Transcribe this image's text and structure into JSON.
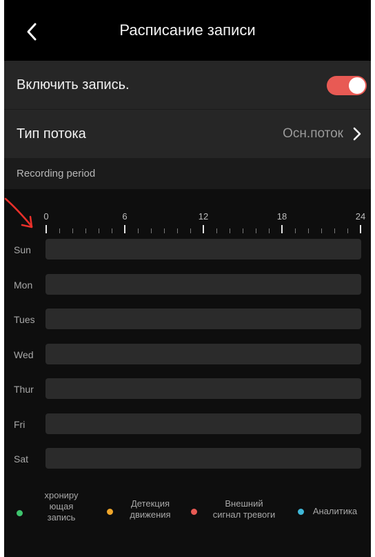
{
  "header": {
    "title": "Расписание записи",
    "back_icon": "chevron-left-icon"
  },
  "settings": {
    "enable": {
      "label": "Включить запись.",
      "toggle_on": true,
      "toggle_color": "#e85a54"
    },
    "stream": {
      "label": "Тип потока",
      "value": "Осн.поток"
    }
  },
  "schedule": {
    "title": "Recording period",
    "hour_labels": [
      "0",
      "6",
      "12",
      "18",
      "24"
    ],
    "days": [
      "Sun",
      "Mon",
      "Tues",
      "Wed",
      "Thur",
      "Fri",
      "Sat"
    ]
  },
  "legend": [
    {
      "label": "хрониру\nющая\nзапись",
      "color": "#3ec46d"
    },
    {
      "label": "Детекция\nдвижения",
      "color": "#f0a62a"
    },
    {
      "label": "Внешний\nсигнал тревоги",
      "color": "#e85a54"
    },
    {
      "label": "Аналитика",
      "color": "#3fb8d8"
    }
  ],
  "annotation_color": "#e8302a"
}
